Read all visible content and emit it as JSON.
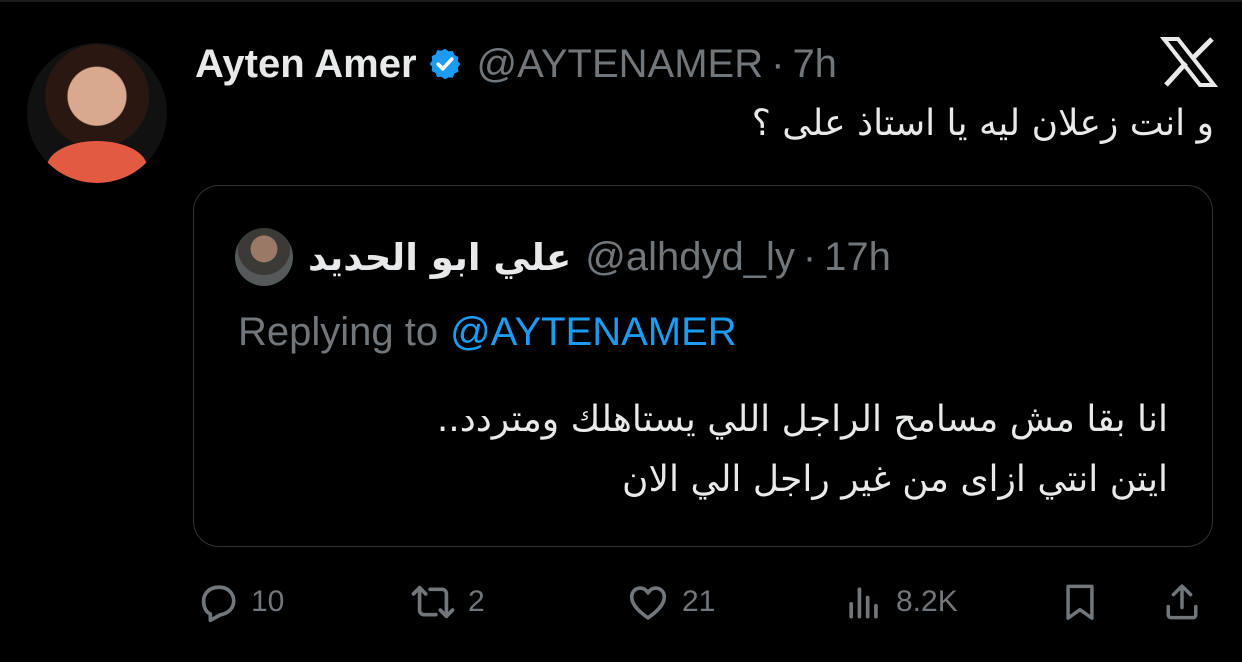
{
  "tweet": {
    "author_name": "Ayten Amer",
    "author_handle": "@AYTENAMER",
    "time_separator": "·",
    "time": "7h",
    "text": "و انت زعلان ليه يا استاذ على ؟"
  },
  "quote": {
    "author_name": "علي ابو الحديد",
    "author_handle": "@alhdyd_ly",
    "time_separator": "·",
    "time": "17h",
    "replying_prefix": "Replying to",
    "replying_handle": "@AYTENAMER",
    "text_lines": [
      "انا بقا مش مسامح الراجل اللي يستاهلك ومتردد..",
      "ايتن انتي ازاى من غير راجل الي الان"
    ]
  },
  "actions": {
    "replies": "10",
    "retweets": "2",
    "likes": "21",
    "views": "8.2K"
  },
  "colors": {
    "background": "#000000",
    "text": "#e7e9ea",
    "muted": "#71767b",
    "accent": "#1d9bf0",
    "border": "#2f3336"
  },
  "icons": [
    "verified-badge-icon",
    "x-logo-icon",
    "reply-icon",
    "retweet-icon",
    "like-icon",
    "views-icon",
    "bookmark-icon",
    "share-icon"
  ]
}
